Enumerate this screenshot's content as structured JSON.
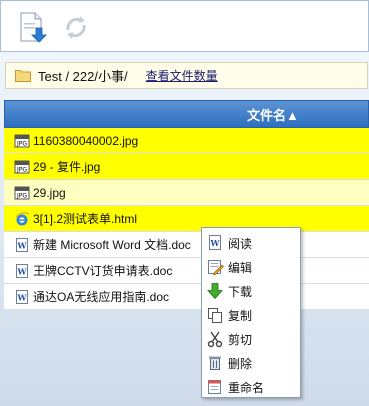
{
  "toolbar": {
    "upload_icon": "upload-icon",
    "refresh_icon": "refresh-icon"
  },
  "pathbar": {
    "path": "Test / 222/小事/",
    "count_link": "查看文件数量"
  },
  "table": {
    "header": "文件名▲",
    "rows": [
      {
        "name": "1160380040002.jpg",
        "type": "jpg"
      },
      {
        "name": "29 - 复件.jpg",
        "type": "jpg"
      },
      {
        "name": "29.jpg",
        "type": "jpg"
      },
      {
        "name": "3[1].2测试表单.html",
        "type": "html"
      },
      {
        "name": "新建 Microsoft Word 文档.doc",
        "type": "doc"
      },
      {
        "name": "王牌CCTV订货申请表.doc",
        "type": "doc"
      },
      {
        "name": "通达OA无线应用指南.doc",
        "type": "doc"
      }
    ]
  },
  "context_menu": {
    "items": [
      {
        "label": "阅读",
        "icon": "read-icon"
      },
      {
        "label": "编辑",
        "icon": "edit-icon"
      },
      {
        "label": "下载",
        "icon": "download-icon"
      },
      {
        "label": "复制",
        "icon": "copy-icon"
      },
      {
        "label": "剪切",
        "icon": "cut-icon"
      },
      {
        "label": "删除",
        "icon": "delete-icon"
      },
      {
        "label": "重命名",
        "icon": "rename-icon"
      }
    ]
  },
  "colors": {
    "highlight_row": "#ffff00",
    "pale_row": "#ffffc0",
    "header_blue": "#2d6fbf"
  }
}
